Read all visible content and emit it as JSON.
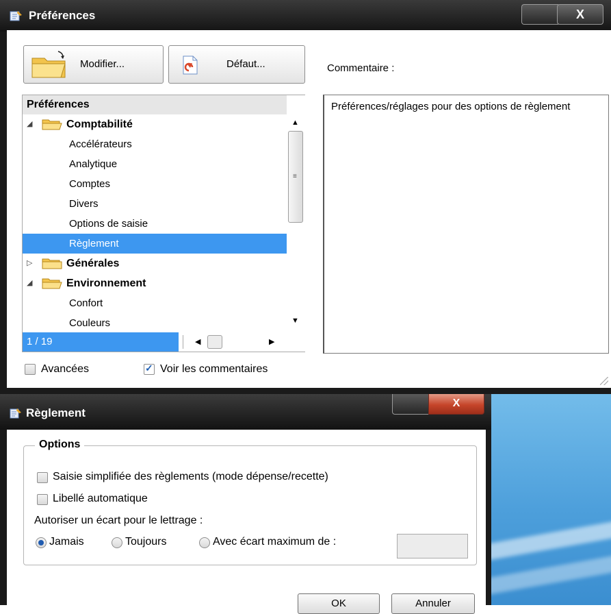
{
  "preferences_window": {
    "title": "Préférences",
    "close_label": "X",
    "buttons": {
      "modify": "Modifier...",
      "default": "Défaut..."
    },
    "comment_label": "Commentaire :",
    "tree": {
      "header": "Préférences",
      "rows": [
        {
          "type": "group",
          "label": "Comptabilité",
          "expanded": true
        },
        {
          "type": "item",
          "label": "Accélérateurs"
        },
        {
          "type": "item",
          "label": "Analytique"
        },
        {
          "type": "item",
          "label": "Comptes"
        },
        {
          "type": "item",
          "label": "Divers"
        },
        {
          "type": "item",
          "label": "Options de saisie"
        },
        {
          "type": "item",
          "label": "Règlement",
          "selected": true
        },
        {
          "type": "group",
          "label": "Générales",
          "expanded": false
        },
        {
          "type": "group",
          "label": "Environnement",
          "expanded": true
        },
        {
          "type": "item",
          "label": "Confort"
        },
        {
          "type": "item",
          "label": "Couleurs"
        }
      ],
      "counter": "1 / 19"
    },
    "comment_text": "Préférences/réglages pour des options de règlement",
    "checkboxes": {
      "advanced": {
        "label": "Avancées",
        "checked": false
      },
      "show_comments": {
        "label": "Voir les commentaires",
        "checked": true
      }
    }
  },
  "reglement_window": {
    "title": "Règlement",
    "close_label": "X",
    "group_title": "Options",
    "options": {
      "simplified": {
        "label": "Saisie simplifiée des règlements (mode dépense/recette)",
        "checked": false
      },
      "auto_label": {
        "label": "Libellé automatique",
        "checked": false
      }
    },
    "lettering_label": "Autoriser un écart pour le lettrage :",
    "radios": [
      {
        "label": "Jamais",
        "selected": true
      },
      {
        "label": "Toujours",
        "selected": false
      },
      {
        "label": "Avec écart maximum de :",
        "selected": false
      }
    ],
    "max_value": "",
    "ok_label": "OK",
    "cancel_label": "Annuler"
  },
  "colors": {
    "selection": "#3d97f0",
    "titlebar": "#1a1a1a",
    "close_red": "#c6452a"
  }
}
